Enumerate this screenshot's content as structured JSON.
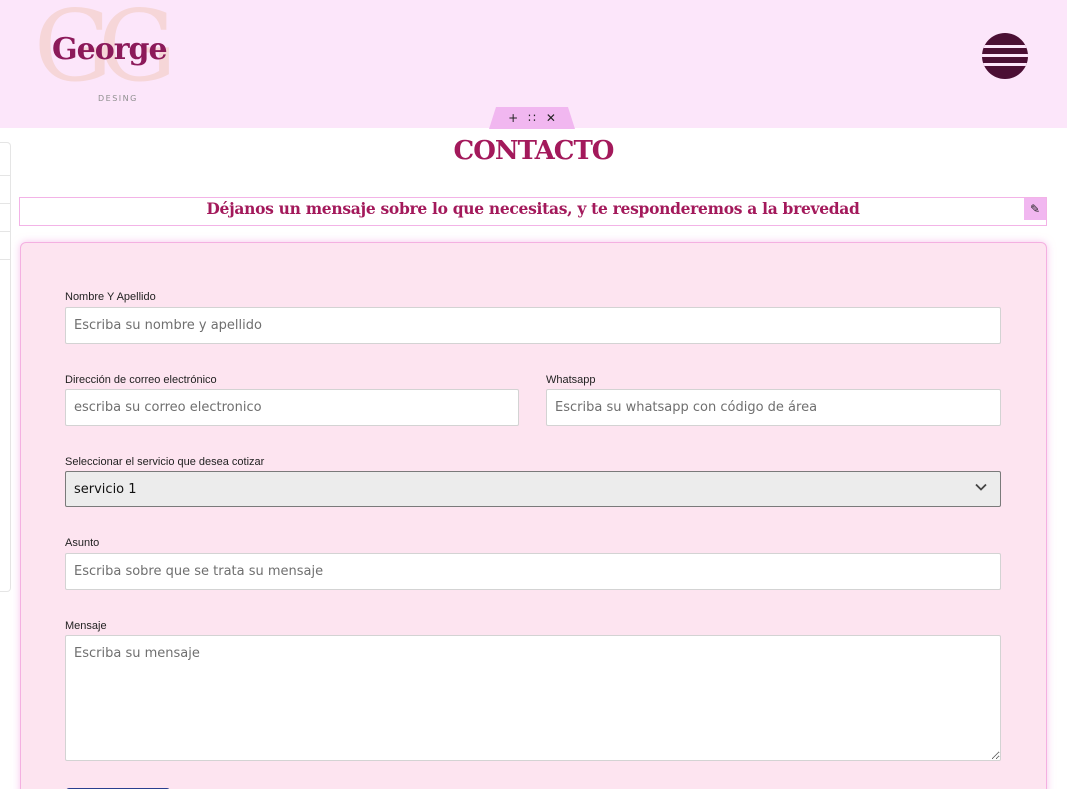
{
  "header": {
    "logo": {
      "monogram": "GG",
      "name": "George",
      "subtitle": "DESING"
    },
    "menu_icon": "hamburger-menu-icon"
  },
  "editor_toolbar": {
    "add": "+",
    "move": "∷",
    "close": "✕",
    "edit": "✎"
  },
  "page": {
    "title": "CONTACTO",
    "subtitle": "Déjanos un mensaje sobre lo que necesitas, y te responderemos a la brevedad"
  },
  "form": {
    "name": {
      "label": "Nombre Y Apellido",
      "placeholder": "Escriba su nombre y apellido"
    },
    "email": {
      "label": "Dirección de correo electrónico",
      "placeholder": "escriba su correo electronico"
    },
    "whatsapp": {
      "label": "Whatsapp",
      "placeholder": "Escriba su whatsapp con código de área"
    },
    "service": {
      "label": "Seleccionar el servicio que desea cotizar",
      "value": "servicio 1"
    },
    "subject": {
      "label": "Asunto",
      "placeholder": "Escriba sobre que se trata su mensaje"
    },
    "message": {
      "label": "Mensaje",
      "placeholder": "Escriba su mensaje"
    }
  },
  "colors": {
    "header_bg": "#fce6fa",
    "brand": "#a3195b",
    "menu_button": "#4b0f34",
    "form_bg": "#fde4f0",
    "toolbar": "#f1b7f0"
  }
}
